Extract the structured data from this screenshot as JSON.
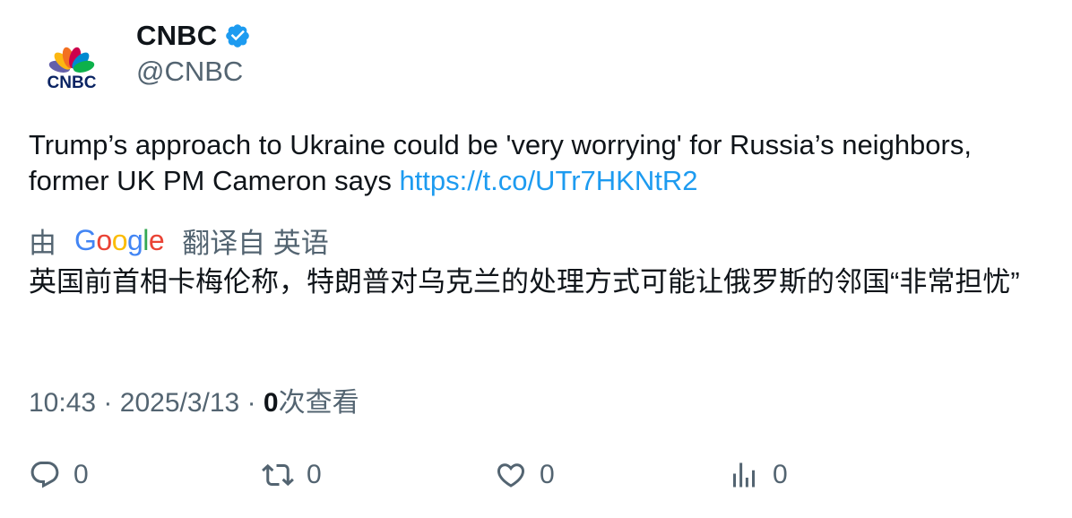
{
  "author": {
    "display_name": "CNBC",
    "handle": "@CNBC",
    "avatar_logo_text": "CNBC",
    "verified_color": "#1d9bf0"
  },
  "tweet": {
    "text": "Trump’s approach to Ukraine could be 'very worrying' for Russia’s neighbors, former UK PM Cameron says ",
    "link": "https://t.co/UTr7HKNtR2",
    "link_color": "#1d9bf0"
  },
  "translation": {
    "prefix": "由",
    "provider": "Google",
    "suffix": "翻译自 英语",
    "text": "英国前首相卡梅伦称，特朗普对乌克兰的处理方式可能让俄罗斯的邻国“非常担忧”"
  },
  "meta": {
    "time": "10:43",
    "separator": "·",
    "date": "2025/3/13",
    "views_count": "0",
    "views_label": "次查看"
  },
  "actions": {
    "reply": {
      "icon": "reply-icon",
      "count": "0"
    },
    "retweet": {
      "icon": "retweet-icon",
      "count": "0"
    },
    "like": {
      "icon": "heart-icon",
      "count": "0"
    },
    "views": {
      "icon": "analytics-icon",
      "count": "0"
    }
  }
}
